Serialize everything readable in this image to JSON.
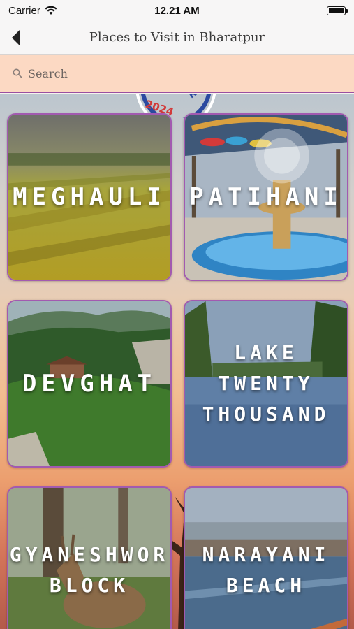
{
  "status_bar": {
    "carrier": "Carrier",
    "time": "12.21 AM"
  },
  "nav": {
    "title": "Places to Visit in Bharatpur"
  },
  "search": {
    "placeholder": "Search",
    "value": ""
  },
  "background": {
    "logo_text": "2024"
  },
  "places": [
    {
      "name": "MEGHAULI",
      "image": "rice-fields"
    },
    {
      "name": "PATIHANI",
      "image": "fountain"
    },
    {
      "name": "DEVGHAT",
      "image": "forest-hills"
    },
    {
      "name": "LAKE\nTWENTY\nTHOUSAND",
      "image": "lake-trees"
    },
    {
      "name": "GYANESHWOR\nBLOCK",
      "image": "deer"
    },
    {
      "name": "NARAYANI\nBEACH",
      "image": "river-city"
    }
  ],
  "colors": {
    "accent_border": "#a25ab0",
    "search_bg": "#fcd9c3",
    "nav_bg": "#f7f6f6"
  }
}
